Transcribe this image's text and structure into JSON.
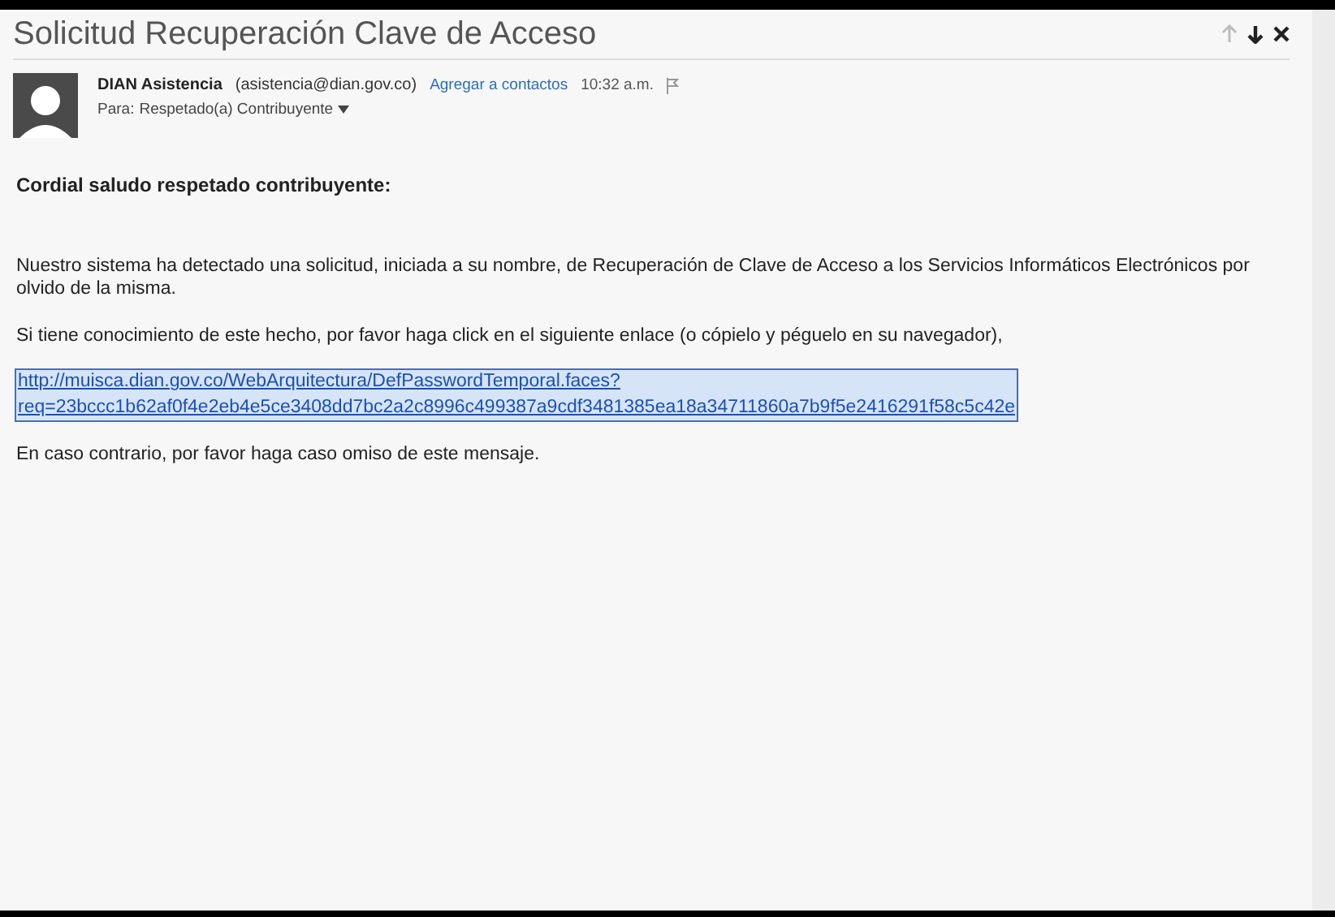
{
  "email": {
    "subject": "Solicitud Recuperación Clave de Acceso",
    "sender_name": "DIAN Asistencia",
    "sender_address": "(asistencia@dian.gov.co)",
    "add_contact": "Agregar a contactos",
    "time": "10:32 a.m.",
    "recipient_label": "Para:",
    "recipient": "Respetado(a) Contribuyente",
    "greeting": "Cordial saludo respetado contribuyente:",
    "paragraphs": [
      "Nuestro sistema ha detectado una solicitud, iniciada a su nombre, de Recuperación de Clave de Acceso a los Servicios Informáticos Electrónicos por olvido de la misma.",
      "Si tiene conocimiento de este hecho, por favor haga click en el siguiente enlace (o cópielo y péguelo en su navegador),"
    ],
    "link": {
      "lines": [
        "http://muisca.dian.gov.co/WebArquitectura/DefPasswordTemporal.faces?",
        "req=23bccc1b62af0f4e2eb4e5ce3408dd7bc2a2c8996c499387a9cdf3481385ea18a34711860a7b9f5e2416291f58c5c42e"
      ],
      "selected": true
    },
    "closing": "En caso contrario, por favor haga caso omiso de este mensaje."
  }
}
